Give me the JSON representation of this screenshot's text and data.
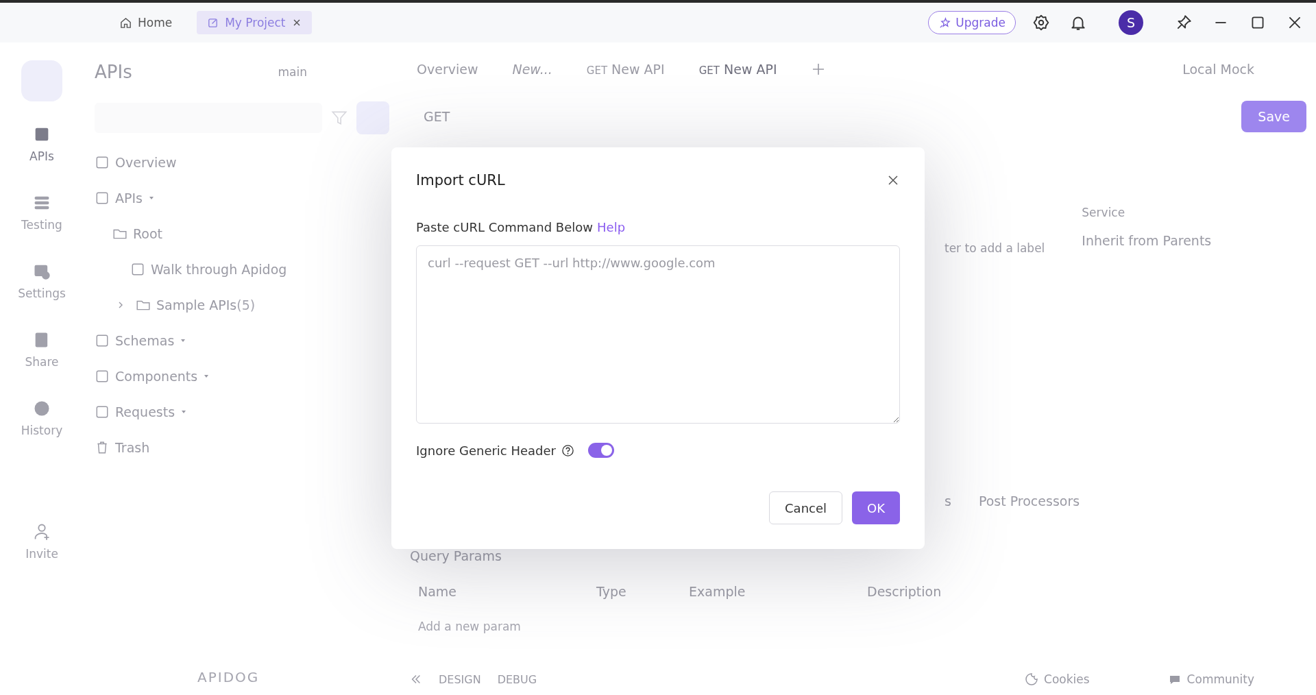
{
  "title_bar": {
    "tabs": [
      {
        "label": "Home",
        "kind": "home",
        "selected": false,
        "closable": false
      },
      {
        "label": "My Project",
        "kind": "project",
        "selected": true,
        "closable": true
      }
    ],
    "upgrade": "Upgrade",
    "avatar": "S"
  },
  "rail": [
    {
      "label": "APIs",
      "kind": "apis",
      "selected": true
    },
    {
      "label": "Testing",
      "kind": "testing",
      "selected": false
    },
    {
      "label": "Settings",
      "kind": "settings",
      "selected": false
    },
    {
      "label": "Share",
      "kind": "share",
      "selected": false
    },
    {
      "label": "History",
      "kind": "history",
      "selected": false
    },
    {
      "label": "Invite",
      "kind": "invite",
      "selected": false
    }
  ],
  "sidebar": {
    "title": "APIs",
    "branch": "main",
    "tree": [
      {
        "label": "Overview",
        "kind": "overview"
      },
      {
        "label": "APIs",
        "kind": "apis",
        "menu": true,
        "children": [
          {
            "label": "Root",
            "kind": "folder",
            "children": [
              {
                "label": "Walk through Apidog",
                "kind": "doc"
              },
              {
                "label": "Sample APIs",
                "count": "(5)",
                "kind": "folder",
                "expanded": false
              }
            ]
          }
        ]
      },
      {
        "label": "Schemas",
        "kind": "schemas",
        "menu": true
      },
      {
        "label": "Components",
        "kind": "components",
        "menu": true
      },
      {
        "label": "Requests",
        "kind": "requests",
        "menu": true
      },
      {
        "label": "Trash",
        "kind": "trash"
      }
    ],
    "logo": "APIDOG"
  },
  "main": {
    "tabs": [
      {
        "label": "Overview",
        "kind": "overview",
        "selected": false
      },
      {
        "label": "New...",
        "kind": "draft",
        "selected": false
      },
      {
        "method": "GET",
        "label": "New API",
        "kind": "api",
        "selected": false
      },
      {
        "method": "GET",
        "label": "New API",
        "kind": "api",
        "selected": true
      }
    ],
    "environment": "Local Mock",
    "method": "GET",
    "save": "Save",
    "label_hint": "ter to add a label",
    "service_label": "Service",
    "service_value": "Inherit from Parents",
    "section_tabs": [
      "s",
      "Post Processors"
    ],
    "params_title": "Query Params",
    "columns": [
      "Name",
      "Type",
      "Example",
      "Description"
    ],
    "add_param": "Add a new param",
    "footer": {
      "modes": [
        "DESIGN",
        "DEBUG"
      ],
      "links": [
        {
          "label": "Cookies",
          "kind": "cookie"
        },
        {
          "label": "Community",
          "kind": "chat"
        }
      ]
    }
  },
  "dialog": {
    "title": "Import cURL",
    "label": "Paste cURL Command Below",
    "help": "Help",
    "placeholder": "curl --request GET --url http://www.google.com",
    "option": {
      "label": "Ignore Generic Header",
      "on": true
    },
    "buttons": [
      {
        "label": "Cancel",
        "kind": "secondary"
      },
      {
        "label": "OK",
        "kind": "primary"
      }
    ]
  }
}
